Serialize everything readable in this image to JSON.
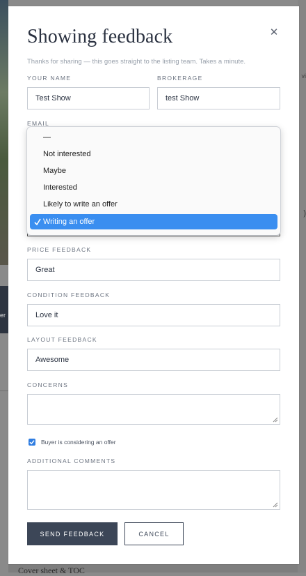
{
  "background": {
    "footer_text": "Cover sheet & TOC",
    "edge_text": "er",
    "right_fragment_1": "vi",
    "right_fragment_2": ")"
  },
  "modal": {
    "title": "Showing feedback",
    "close_icon": "close-icon",
    "intro": "Thanks for sharing — this goes straight to the listing team. Takes a minute."
  },
  "fields": {
    "name": {
      "label": "YOUR NAME",
      "value": "Test Show"
    },
    "brokerage": {
      "label": "BROKERAGE",
      "value": "test Show"
    },
    "email": {
      "label": "EMAIL"
    },
    "price": {
      "label": "PRICE FEEDBACK",
      "value": "Great"
    },
    "condition": {
      "label": "CONDITION FEEDBACK",
      "value": "Love it"
    },
    "layout": {
      "label": "LAYOUT FEEDBACK",
      "value": "Awesome"
    },
    "concerns": {
      "label": "CONCERNS",
      "value": ""
    },
    "additional": {
      "label": "ADDITIONAL COMMENTS",
      "value": ""
    }
  },
  "checkbox": {
    "label": "Buyer is considering an offer",
    "checked": true
  },
  "interest_dropdown": {
    "options": [
      "—",
      "Not interested",
      "Maybe",
      "Interested",
      "Likely to write an offer",
      "Writing an offer"
    ],
    "selected": "Writing an offer",
    "accent_color": "#3a8ef0"
  },
  "buttons": {
    "submit": "SEND FEEDBACK",
    "cancel": "CANCEL"
  }
}
